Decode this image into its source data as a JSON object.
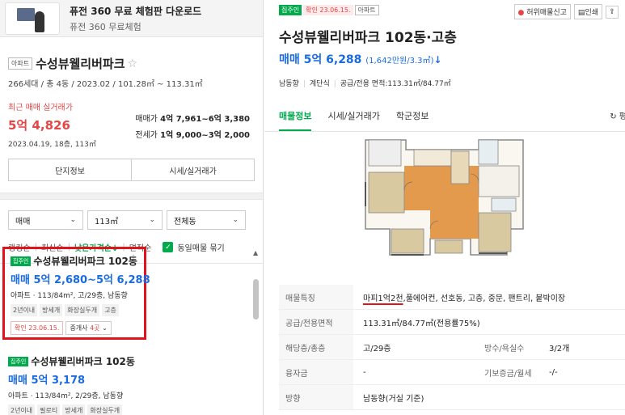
{
  "banner": {
    "title": "퓨전 360 무료 체험판 다운로드",
    "subtitle": "퓨전 360 무료체험"
  },
  "complex": {
    "type_badge": "아파트",
    "name": "수성뷰웰리버파크",
    "meta": "266세대 / 총 4동 / 2023.02 / 101.28㎡ ~ 113.31㎡",
    "recent_label": "최근 매매 실거래가",
    "recent_price": "5억 4,826",
    "recent_date": "2023.04.19, 18층, 113㎡",
    "sale_label": "매매가",
    "sale_range": "4억 7,961~6억 3,380",
    "jeonse_label": "전세가",
    "jeonse_range": "1억 9,000~3억 2,000",
    "btn_info": "단지정보",
    "btn_trade": "시세/실거래가"
  },
  "filters": {
    "deal": "매매",
    "area": "113㎡",
    "dong": "전체동"
  },
  "sort": {
    "ranking": "랭킹순",
    "latest": "최신순",
    "low_price": "낮은가격순",
    "area": "면적순",
    "same_listing": "동일매물 묶기"
  },
  "listings": [
    {
      "owner_badge": "집주인",
      "name": "수성뷰웰리버파크 102동",
      "price": "매매 5억 2,680~5억 6,288",
      "spec": "아파트 · 113/84m², 고/29층, 남동향",
      "tags": [
        "2년이내",
        "방세개",
        "화장실두개",
        "고층"
      ],
      "confirm": "확인 23.06.15.",
      "broker_label": "중개사",
      "broker_count": "4곳"
    },
    {
      "owner_badge": "집주인",
      "name": "수성뷰웰리버파크 102동",
      "price": "매매 5억 3,178",
      "spec": "아파트 · 113/84m², 2/29층, 남동향",
      "tags": [
        "2년이내",
        "필로티",
        "방세개",
        "화장실두개"
      ]
    }
  ],
  "detail": {
    "owner_badge": "집주인",
    "confirm_badge": "확인 23.06.15.",
    "type_badge": "아파트",
    "report_btn": "허위매물신고",
    "print_btn": "인쇄",
    "title": "수성뷰웰리버파크 102동·고층",
    "price_main": "매매 5억 6,288",
    "price_unit": "(1,642만원/3.3㎡)",
    "summary": [
      "남동향",
      "계단식",
      "공급/전용 면적:113.31㎡/84.77㎡"
    ],
    "tabs": [
      "매물정보",
      "시세/실거래가",
      "학군정보"
    ],
    "refresh_label": "평",
    "rows": [
      {
        "k": "매물특징",
        "v_underlined": "마피1억2천",
        "v_rest": ",풀에어컨, 선호동, 고층, 중문, 팬트리, 붙박이장"
      },
      {
        "k": "공급/전용면적",
        "v": "113.31㎡/84.77㎡(전용률75%)"
      },
      {
        "k": "해당층/총층",
        "v": "고/29층",
        "k2": "방수/욕실수",
        "v2": "3/2개"
      },
      {
        "k": "융자금",
        "v": "-",
        "k2": "기보증금/월세",
        "v2": "-/-"
      },
      {
        "k": "방향",
        "v": "남동향(거실 기준)"
      }
    ]
  },
  "colors": {
    "brand_green": "#03a94d",
    "price_blue": "#1a6be0",
    "alert_red": "#e64545",
    "highlight_red": "#e0141a"
  }
}
